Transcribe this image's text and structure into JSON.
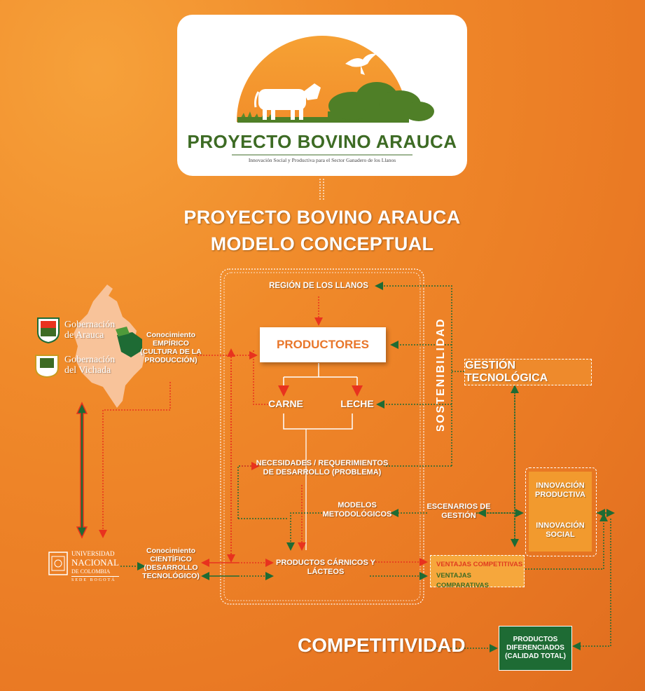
{
  "logo": {
    "title": "PROYECTO BOVINO ARAUCA",
    "subtitle": "Innovación Social y Productiva para el Sector Ganadero de los Llanos"
  },
  "header": {
    "title_line1": "PROYECTO BOVINO ARAUCA",
    "title_line2": "MODELO CONCEPTUAL"
  },
  "nodes": {
    "region": "REGIÓN DE LOS LLANOS",
    "productores": "PRODUCTORES",
    "carne": "CARNE",
    "leche": "LECHE",
    "necesidades_1": "NECESIDADES / REQUERIMIENTOS",
    "necesidades_2": "DE DESARROLLO (PROBLEMA)",
    "modelos_1": "MODELOS",
    "modelos_2": "METODOLÓGICOS",
    "escenarios_1": "ESCENARIOS DE",
    "escenarios_2": "GESTIÓN",
    "productos_1": "PRODUCTOS CÁRNICOS Y",
    "productos_2": "LÁCTEOS",
    "sostenibilidad": "SOSTENIBILIDAD",
    "gestion": "GESTIÓN TECNOLÓGICA",
    "innov_prod_1": "INNOVACIÓN",
    "innov_prod_2": "PRODUCTIVA",
    "innov_soc_1": "INNOVACIÓN",
    "innov_soc_2": "SOCIAL",
    "ventaja_comp": "VENTAJAS COMPETITIVAS",
    "ventaja_compar": "VENTAJAS COMPARATIVAS",
    "diferenciados_1": "PRODUCTOS",
    "diferenciados_2": "DIFERENCIADOS",
    "diferenciados_3": "(CALIDAD TOTAL)",
    "competitividad": "COMPETITIVIDAD",
    "empirico_1": "Conocimiento",
    "empirico_2": "EMPÍRICO",
    "empirico_3": "(CULTURA DE LA",
    "empirico_4": "PRODUCCIÓN)",
    "cientifico_1": "Conocimiento",
    "cientifico_2": "CIENTÍFICO",
    "cientifico_3": "(DESARROLLO",
    "cientifico_4": "TECNOLÓGICO)"
  },
  "partners": {
    "arauca_1": "Gobernación",
    "arauca_2": "de Arauca",
    "vichada_1": "Gobernación",
    "vichada_2": "del Vichada",
    "unal_1": "UNIVERSIDAD",
    "unal_2": "NACIONAL",
    "unal_3": "DE COLOMBIA",
    "unal_4": "SEDE BOGOTÁ"
  },
  "colors": {
    "background": "#ea7a24",
    "red_arrow": "#e8321e",
    "green_arrow": "#1e6b34",
    "logo_green": "#3d6b24",
    "productores_text": "#e8762a"
  }
}
